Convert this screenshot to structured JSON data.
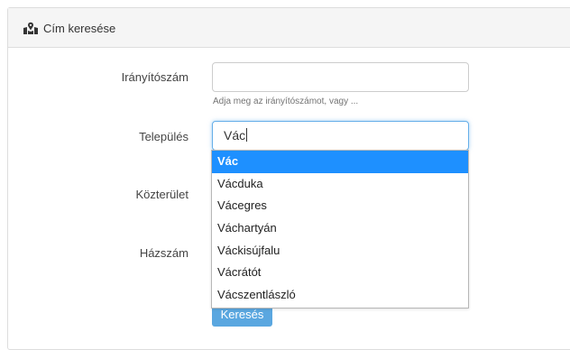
{
  "panel": {
    "title": "Cím keresése",
    "icon": "map-icon"
  },
  "form": {
    "postcode_label": "Irányítószám",
    "postcode_value": "",
    "postcode_help": "Adja meg az irányítószámot, vagy ...",
    "city_label": "Település",
    "city_value": "Vác",
    "street_label": "Közterület",
    "house_label": "Házszám",
    "search_button": "Keresés"
  },
  "autocomplete": {
    "items": [
      "Vác",
      "Vácduka",
      "Vácegres",
      "Váchartyán",
      "Váckisújfalu",
      "Vácrátót",
      "Vácszentlászló"
    ],
    "highlight_color": "#1e90ff"
  }
}
